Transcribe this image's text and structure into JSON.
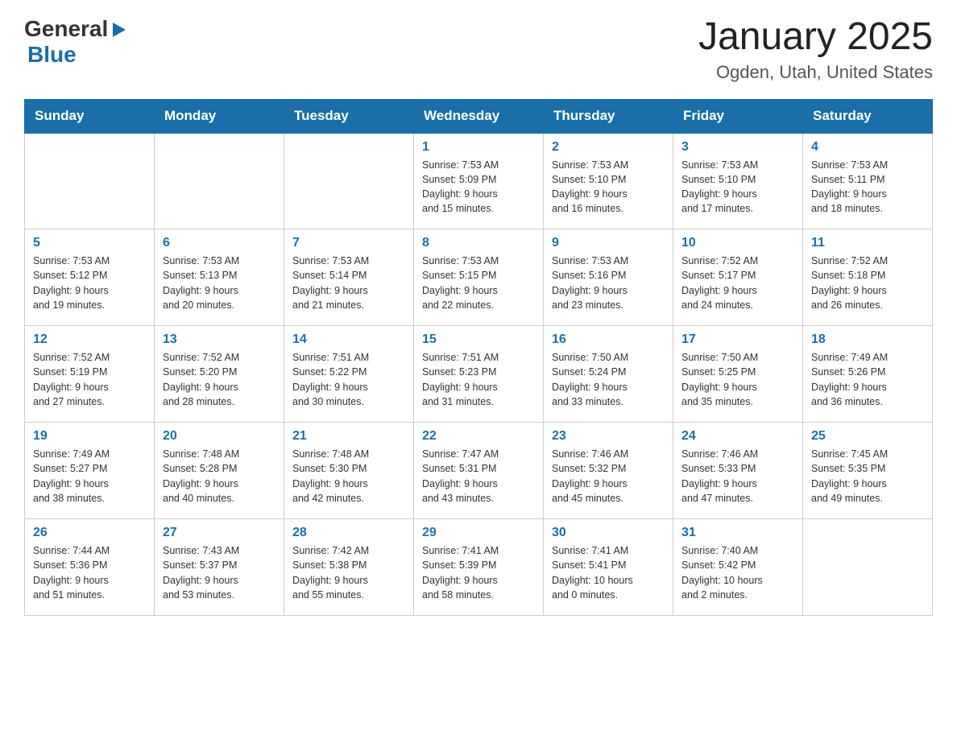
{
  "header": {
    "logo": {
      "general": "General",
      "triangle": "▶",
      "blue": "Blue"
    },
    "title": "January 2025",
    "subtitle": "Ogden, Utah, United States"
  },
  "days_of_week": [
    "Sunday",
    "Monday",
    "Tuesday",
    "Wednesday",
    "Thursday",
    "Friday",
    "Saturday"
  ],
  "weeks": [
    [
      {
        "day": "",
        "info": ""
      },
      {
        "day": "",
        "info": ""
      },
      {
        "day": "",
        "info": ""
      },
      {
        "day": "1",
        "info": "Sunrise: 7:53 AM\nSunset: 5:09 PM\nDaylight: 9 hours\nand 15 minutes."
      },
      {
        "day": "2",
        "info": "Sunrise: 7:53 AM\nSunset: 5:10 PM\nDaylight: 9 hours\nand 16 minutes."
      },
      {
        "day": "3",
        "info": "Sunrise: 7:53 AM\nSunset: 5:10 PM\nDaylight: 9 hours\nand 17 minutes."
      },
      {
        "day": "4",
        "info": "Sunrise: 7:53 AM\nSunset: 5:11 PM\nDaylight: 9 hours\nand 18 minutes."
      }
    ],
    [
      {
        "day": "5",
        "info": "Sunrise: 7:53 AM\nSunset: 5:12 PM\nDaylight: 9 hours\nand 19 minutes."
      },
      {
        "day": "6",
        "info": "Sunrise: 7:53 AM\nSunset: 5:13 PM\nDaylight: 9 hours\nand 20 minutes."
      },
      {
        "day": "7",
        "info": "Sunrise: 7:53 AM\nSunset: 5:14 PM\nDaylight: 9 hours\nand 21 minutes."
      },
      {
        "day": "8",
        "info": "Sunrise: 7:53 AM\nSunset: 5:15 PM\nDaylight: 9 hours\nand 22 minutes."
      },
      {
        "day": "9",
        "info": "Sunrise: 7:53 AM\nSunset: 5:16 PM\nDaylight: 9 hours\nand 23 minutes."
      },
      {
        "day": "10",
        "info": "Sunrise: 7:52 AM\nSunset: 5:17 PM\nDaylight: 9 hours\nand 24 minutes."
      },
      {
        "day": "11",
        "info": "Sunrise: 7:52 AM\nSunset: 5:18 PM\nDaylight: 9 hours\nand 26 minutes."
      }
    ],
    [
      {
        "day": "12",
        "info": "Sunrise: 7:52 AM\nSunset: 5:19 PM\nDaylight: 9 hours\nand 27 minutes."
      },
      {
        "day": "13",
        "info": "Sunrise: 7:52 AM\nSunset: 5:20 PM\nDaylight: 9 hours\nand 28 minutes."
      },
      {
        "day": "14",
        "info": "Sunrise: 7:51 AM\nSunset: 5:22 PM\nDaylight: 9 hours\nand 30 minutes."
      },
      {
        "day": "15",
        "info": "Sunrise: 7:51 AM\nSunset: 5:23 PM\nDaylight: 9 hours\nand 31 minutes."
      },
      {
        "day": "16",
        "info": "Sunrise: 7:50 AM\nSunset: 5:24 PM\nDaylight: 9 hours\nand 33 minutes."
      },
      {
        "day": "17",
        "info": "Sunrise: 7:50 AM\nSunset: 5:25 PM\nDaylight: 9 hours\nand 35 minutes."
      },
      {
        "day": "18",
        "info": "Sunrise: 7:49 AM\nSunset: 5:26 PM\nDaylight: 9 hours\nand 36 minutes."
      }
    ],
    [
      {
        "day": "19",
        "info": "Sunrise: 7:49 AM\nSunset: 5:27 PM\nDaylight: 9 hours\nand 38 minutes."
      },
      {
        "day": "20",
        "info": "Sunrise: 7:48 AM\nSunset: 5:28 PM\nDaylight: 9 hours\nand 40 minutes."
      },
      {
        "day": "21",
        "info": "Sunrise: 7:48 AM\nSunset: 5:30 PM\nDaylight: 9 hours\nand 42 minutes."
      },
      {
        "day": "22",
        "info": "Sunrise: 7:47 AM\nSunset: 5:31 PM\nDaylight: 9 hours\nand 43 minutes."
      },
      {
        "day": "23",
        "info": "Sunrise: 7:46 AM\nSunset: 5:32 PM\nDaylight: 9 hours\nand 45 minutes."
      },
      {
        "day": "24",
        "info": "Sunrise: 7:46 AM\nSunset: 5:33 PM\nDaylight: 9 hours\nand 47 minutes."
      },
      {
        "day": "25",
        "info": "Sunrise: 7:45 AM\nSunset: 5:35 PM\nDaylight: 9 hours\nand 49 minutes."
      }
    ],
    [
      {
        "day": "26",
        "info": "Sunrise: 7:44 AM\nSunset: 5:36 PM\nDaylight: 9 hours\nand 51 minutes."
      },
      {
        "day": "27",
        "info": "Sunrise: 7:43 AM\nSunset: 5:37 PM\nDaylight: 9 hours\nand 53 minutes."
      },
      {
        "day": "28",
        "info": "Sunrise: 7:42 AM\nSunset: 5:38 PM\nDaylight: 9 hours\nand 55 minutes."
      },
      {
        "day": "29",
        "info": "Sunrise: 7:41 AM\nSunset: 5:39 PM\nDaylight: 9 hours\nand 58 minutes."
      },
      {
        "day": "30",
        "info": "Sunrise: 7:41 AM\nSunset: 5:41 PM\nDaylight: 10 hours\nand 0 minutes."
      },
      {
        "day": "31",
        "info": "Sunrise: 7:40 AM\nSunset: 5:42 PM\nDaylight: 10 hours\nand 2 minutes."
      },
      {
        "day": "",
        "info": ""
      }
    ]
  ]
}
